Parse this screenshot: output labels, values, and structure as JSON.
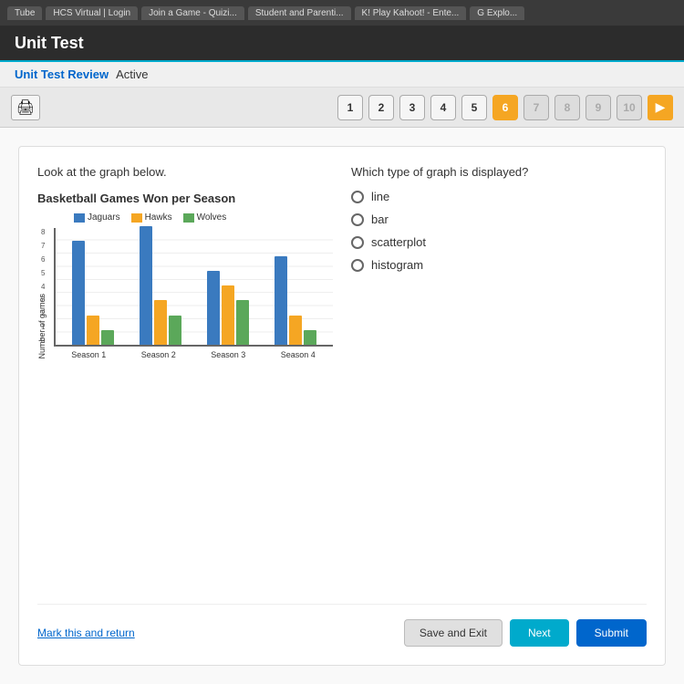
{
  "browser": {
    "tabs": [
      "Tube",
      "HCS Virtual | Login",
      "Join a Game - Quizi...",
      "Student and Parenti...",
      "K! Play Kahoot! - Ente...",
      "G Explo..."
    ]
  },
  "header": {
    "title": "Unit Test"
  },
  "breadcrumb": {
    "link": "Unit Test Review",
    "separator": "",
    "status": "Active"
  },
  "questionNav": {
    "printLabel": "🖨",
    "buttons": [
      "1",
      "2",
      "3",
      "4",
      "5",
      "6",
      "7",
      "8",
      "9",
      "10"
    ],
    "activePage": "6",
    "nextIcon": "▶"
  },
  "question": {
    "prompt": "Look at the graph below.",
    "chartTitle": "Basketball Games Won per Season",
    "legend": [
      {
        "label": "Jaguars",
        "color": "#3a7abf"
      },
      {
        "label": "Hawks",
        "color": "#f5a623"
      },
      {
        "label": "Wolves",
        "color": "#5ba85a"
      }
    ],
    "yAxisLabel": "Number of games",
    "yTicks": [
      "0",
      "1",
      "2",
      "3",
      "4",
      "5",
      "6",
      "7",
      "8"
    ],
    "seasons": [
      {
        "label": "Season 1",
        "jaguars": 7,
        "hawks": 2,
        "wolves": 1
      },
      {
        "label": "Season 2",
        "jaguars": 8,
        "hawks": 3,
        "wolves": 2
      },
      {
        "label": "Season 3",
        "jaguars": 5,
        "hawks": 4,
        "wolves": 3
      },
      {
        "label": "Season 4",
        "jaguars": 6,
        "hawks": 2,
        "wolves": 1
      }
    ],
    "answerPrompt": "Which type of graph is displayed?",
    "choices": [
      "line",
      "bar",
      "scatterplot",
      "histogram"
    ]
  },
  "footer": {
    "markReturn": "Mark this and return",
    "saveExit": "Save and Exit",
    "next": "Next",
    "submit": "Submit"
  }
}
